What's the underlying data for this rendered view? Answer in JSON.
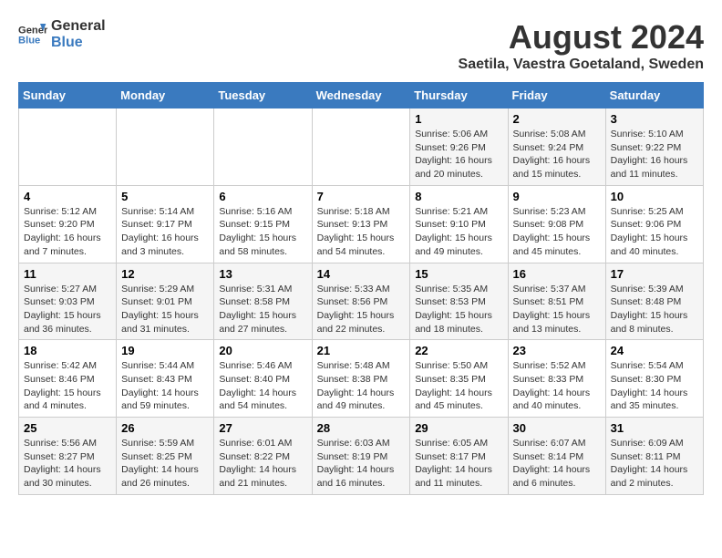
{
  "header": {
    "logo_line1": "General",
    "logo_line2": "Blue",
    "title": "August 2024",
    "subtitle": "Saetila, Vaestra Goetaland, Sweden"
  },
  "days_of_week": [
    "Sunday",
    "Monday",
    "Tuesday",
    "Wednesday",
    "Thursday",
    "Friday",
    "Saturday"
  ],
  "weeks": [
    [
      {
        "day": "",
        "detail": ""
      },
      {
        "day": "",
        "detail": ""
      },
      {
        "day": "",
        "detail": ""
      },
      {
        "day": "",
        "detail": ""
      },
      {
        "day": "1",
        "detail": "Sunrise: 5:06 AM\nSunset: 9:26 PM\nDaylight: 16 hours\nand 20 minutes."
      },
      {
        "day": "2",
        "detail": "Sunrise: 5:08 AM\nSunset: 9:24 PM\nDaylight: 16 hours\nand 15 minutes."
      },
      {
        "day": "3",
        "detail": "Sunrise: 5:10 AM\nSunset: 9:22 PM\nDaylight: 16 hours\nand 11 minutes."
      }
    ],
    [
      {
        "day": "4",
        "detail": "Sunrise: 5:12 AM\nSunset: 9:20 PM\nDaylight: 16 hours\nand 7 minutes."
      },
      {
        "day": "5",
        "detail": "Sunrise: 5:14 AM\nSunset: 9:17 PM\nDaylight: 16 hours\nand 3 minutes."
      },
      {
        "day": "6",
        "detail": "Sunrise: 5:16 AM\nSunset: 9:15 PM\nDaylight: 15 hours\nand 58 minutes."
      },
      {
        "day": "7",
        "detail": "Sunrise: 5:18 AM\nSunset: 9:13 PM\nDaylight: 15 hours\nand 54 minutes."
      },
      {
        "day": "8",
        "detail": "Sunrise: 5:21 AM\nSunset: 9:10 PM\nDaylight: 15 hours\nand 49 minutes."
      },
      {
        "day": "9",
        "detail": "Sunrise: 5:23 AM\nSunset: 9:08 PM\nDaylight: 15 hours\nand 45 minutes."
      },
      {
        "day": "10",
        "detail": "Sunrise: 5:25 AM\nSunset: 9:06 PM\nDaylight: 15 hours\nand 40 minutes."
      }
    ],
    [
      {
        "day": "11",
        "detail": "Sunrise: 5:27 AM\nSunset: 9:03 PM\nDaylight: 15 hours\nand 36 minutes."
      },
      {
        "day": "12",
        "detail": "Sunrise: 5:29 AM\nSunset: 9:01 PM\nDaylight: 15 hours\nand 31 minutes."
      },
      {
        "day": "13",
        "detail": "Sunrise: 5:31 AM\nSunset: 8:58 PM\nDaylight: 15 hours\nand 27 minutes."
      },
      {
        "day": "14",
        "detail": "Sunrise: 5:33 AM\nSunset: 8:56 PM\nDaylight: 15 hours\nand 22 minutes."
      },
      {
        "day": "15",
        "detail": "Sunrise: 5:35 AM\nSunset: 8:53 PM\nDaylight: 15 hours\nand 18 minutes."
      },
      {
        "day": "16",
        "detail": "Sunrise: 5:37 AM\nSunset: 8:51 PM\nDaylight: 15 hours\nand 13 minutes."
      },
      {
        "day": "17",
        "detail": "Sunrise: 5:39 AM\nSunset: 8:48 PM\nDaylight: 15 hours\nand 8 minutes."
      }
    ],
    [
      {
        "day": "18",
        "detail": "Sunrise: 5:42 AM\nSunset: 8:46 PM\nDaylight: 15 hours\nand 4 minutes."
      },
      {
        "day": "19",
        "detail": "Sunrise: 5:44 AM\nSunset: 8:43 PM\nDaylight: 14 hours\nand 59 minutes."
      },
      {
        "day": "20",
        "detail": "Sunrise: 5:46 AM\nSunset: 8:40 PM\nDaylight: 14 hours\nand 54 minutes."
      },
      {
        "day": "21",
        "detail": "Sunrise: 5:48 AM\nSunset: 8:38 PM\nDaylight: 14 hours\nand 49 minutes."
      },
      {
        "day": "22",
        "detail": "Sunrise: 5:50 AM\nSunset: 8:35 PM\nDaylight: 14 hours\nand 45 minutes."
      },
      {
        "day": "23",
        "detail": "Sunrise: 5:52 AM\nSunset: 8:33 PM\nDaylight: 14 hours\nand 40 minutes."
      },
      {
        "day": "24",
        "detail": "Sunrise: 5:54 AM\nSunset: 8:30 PM\nDaylight: 14 hours\nand 35 minutes."
      }
    ],
    [
      {
        "day": "25",
        "detail": "Sunrise: 5:56 AM\nSunset: 8:27 PM\nDaylight: 14 hours\nand 30 minutes."
      },
      {
        "day": "26",
        "detail": "Sunrise: 5:59 AM\nSunset: 8:25 PM\nDaylight: 14 hours\nand 26 minutes."
      },
      {
        "day": "27",
        "detail": "Sunrise: 6:01 AM\nSunset: 8:22 PM\nDaylight: 14 hours\nand 21 minutes."
      },
      {
        "day": "28",
        "detail": "Sunrise: 6:03 AM\nSunset: 8:19 PM\nDaylight: 14 hours\nand 16 minutes."
      },
      {
        "day": "29",
        "detail": "Sunrise: 6:05 AM\nSunset: 8:17 PM\nDaylight: 14 hours\nand 11 minutes."
      },
      {
        "day": "30",
        "detail": "Sunrise: 6:07 AM\nSunset: 8:14 PM\nDaylight: 14 hours\nand 6 minutes."
      },
      {
        "day": "31",
        "detail": "Sunrise: 6:09 AM\nSunset: 8:11 PM\nDaylight: 14 hours\nand 2 minutes."
      }
    ]
  ]
}
